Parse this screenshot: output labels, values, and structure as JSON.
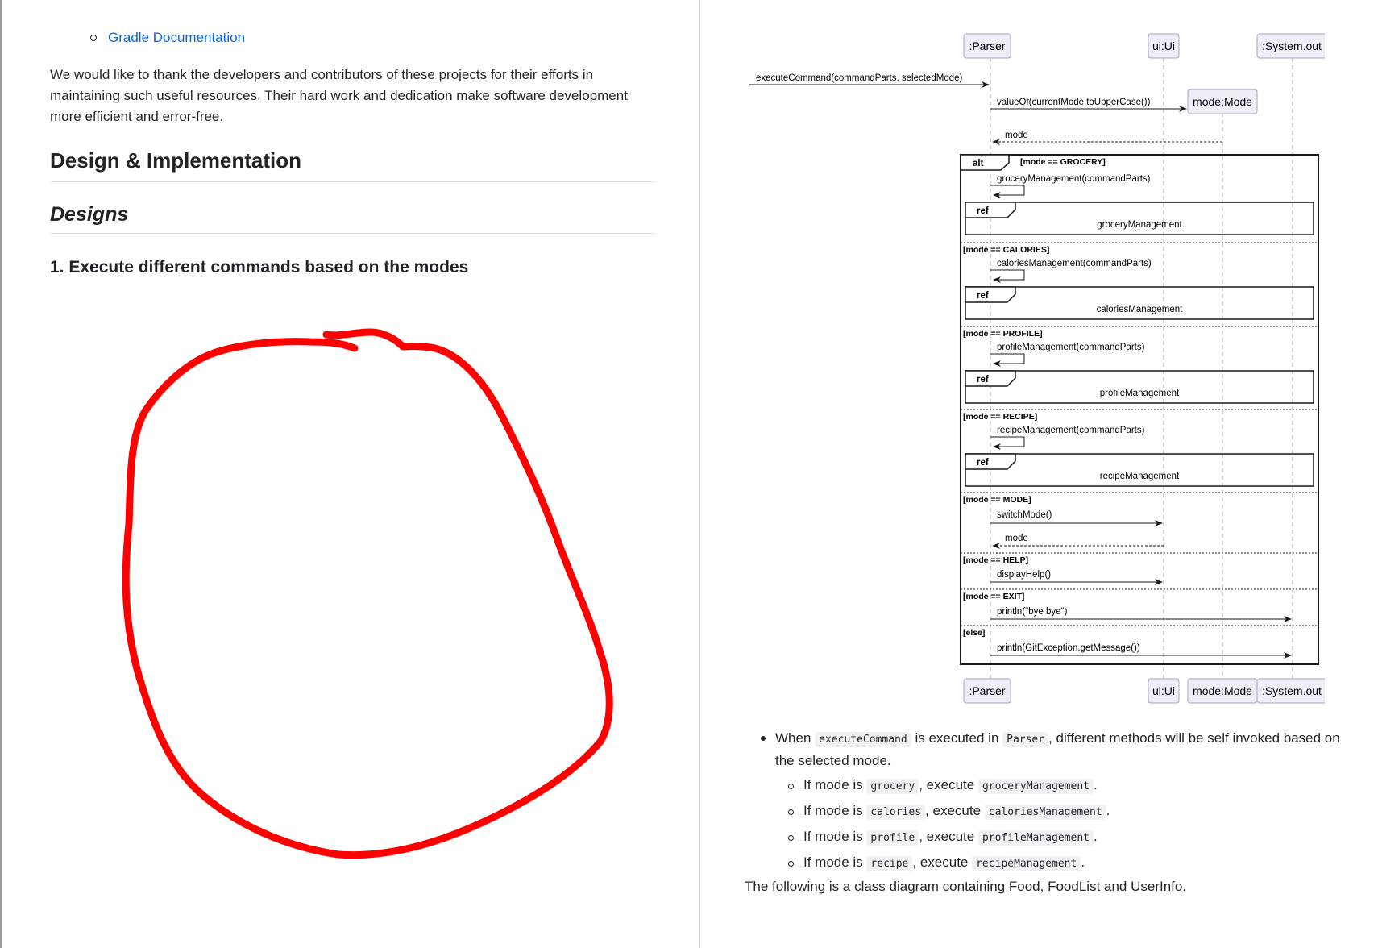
{
  "left": {
    "link": "Gradle Documentation",
    "paragraph": "We would like to thank the developers and contributors of these projects for their efforts in maintaining such useful resources. Their hard work and dedication make software development more efficient and error-free.",
    "heading_design": "Design & Implementation",
    "heading_designs": "Designs",
    "heading_item": "1. Execute different commands based on the modes"
  },
  "diagram": {
    "participants": [
      ":Parser",
      "ui:Ui",
      "mode:Mode",
      ":System.out"
    ],
    "incoming_message": "executeCommand(commandParts, selectedMode)",
    "create_message": "valueOf(currentMode.toUpperCase())",
    "return_mode": "mode",
    "alt_label": "alt",
    "ref_label": "ref",
    "branches": [
      {
        "guard": "[mode == GROCERY]",
        "call": "groceryManagement(commandParts)",
        "ref": "groceryManagement"
      },
      {
        "guard": "[mode == CALORIES]",
        "call": "caloriesManagement(commandParts)",
        "ref": "caloriesManagement"
      },
      {
        "guard": "[mode == PROFILE]",
        "call": "profileManagement(commandParts)",
        "ref": "profileManagement"
      },
      {
        "guard": "[mode == RECIPE]",
        "call": "recipeManagement(commandParts)",
        "ref": "recipeManagement"
      },
      {
        "guard": "[mode == MODE]",
        "call": "switchMode()",
        "return": "mode"
      },
      {
        "guard": "[mode == HELP]",
        "call": "displayHelp()"
      },
      {
        "guard": "[mode == EXIT]",
        "call": "println(\"bye bye\")"
      },
      {
        "guard": "[else]",
        "call": "println(GitException.getMessage())"
      }
    ]
  },
  "description": {
    "intro_1": "When ",
    "intro_code_1": "executeCommand",
    "intro_2": " is executed in ",
    "intro_code_2": "Parser",
    "intro_3": ", different methods will be self invoked based on the selected mode.",
    "items": [
      {
        "prefix": "If mode is ",
        "mode": "grocery",
        "mid": ", execute ",
        "method": "groceryManagement",
        "end": "."
      },
      {
        "prefix": "If mode is ",
        "mode": "calories",
        "mid": ", execute ",
        "method": "caloriesManagement",
        "end": "."
      },
      {
        "prefix": "If mode is ",
        "mode": "profile",
        "mid": ", execute ",
        "method": "profileManagement",
        "end": "."
      },
      {
        "prefix": "If mode is ",
        "mode": "recipe",
        "mid": ", execute ",
        "method": "recipeManagement",
        "end": "."
      }
    ],
    "closing": "The following is a class diagram containing Food, FoodList and UserInfo."
  },
  "colors": {
    "link": "#0969da",
    "annotation": "#ff0000",
    "participant_fill": "#eeeef7",
    "participant_border": "#a6a6c4"
  }
}
